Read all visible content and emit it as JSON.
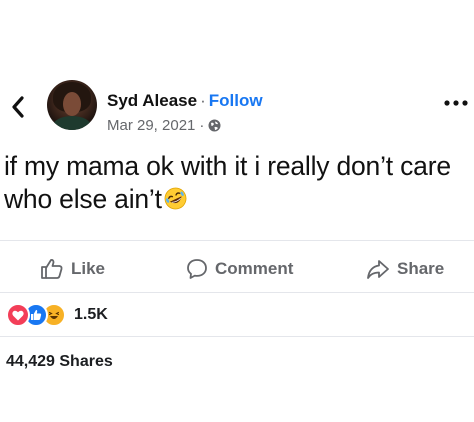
{
  "post": {
    "author": "Syd Alease",
    "separator": "·",
    "follow_label": "Follow",
    "date": "Mar 29, 2021",
    "meta_separator": "·",
    "text": "if my mama ok with it i really don’t care who else ain’t",
    "emoji_icon": "rolling-on-floor-laughing-icon",
    "privacy_icon": "globe-icon"
  },
  "actions": {
    "like_label": "Like",
    "comment_label": "Comment",
    "share_label": "Share"
  },
  "reactions": {
    "types": [
      "love",
      "like",
      "haha"
    ],
    "count": "1.5K"
  },
  "shares": {
    "label": "44,429 Shares"
  },
  "colors": {
    "follow": "#1877f2",
    "secondary_text": "#65676b",
    "divider": "#e4e6eb",
    "love": "#f33e58",
    "like": "#1877f2",
    "haha": "#f7b125"
  }
}
